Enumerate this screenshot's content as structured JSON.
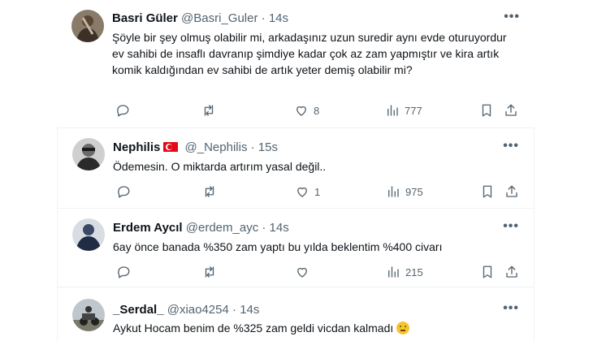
{
  "colors": {
    "text": "#0f1419",
    "secondary": "#536471",
    "divider": "#eff3f4",
    "flag_red": "#e30a17"
  },
  "tweets": [
    {
      "name": "Basri Güler",
      "handle": "@Basri_Guler",
      "time": "14s",
      "text": "Şöyle bir şey olmuş olabilir mi, arkadaşınız uzun suredir aynı evde oturuyordur ev sahibi de insaflı davranıp şimdiye kadar çok az zam yapmıştır ve kira artık komik kaldığından ev sahibi de artık yeter demiş olabilir mi?",
      "likes": "8",
      "views": "777"
    },
    {
      "name": "Nephilis",
      "flag": "turkey-flag",
      "handle": "@_Nephilis",
      "time": "15s",
      "text": "Ödemesin. O miktarda artırım yasal değil..",
      "likes": "1",
      "views": "975"
    },
    {
      "name": "Erdem Aycıl",
      "handle": "@erdem_ayc",
      "time": "14s",
      "text": "6ay önce banada %350 zam yaptı bu yılda beklentim %400 civarı",
      "likes": "",
      "views": "215"
    },
    {
      "name": "_Serdal_",
      "handle": "@xiao4254",
      "time": "14s",
      "text": "Aykut Hocam benim de %325 zam geldi vicdan kalmadı",
      "emoji": "neutral-face-emoji"
    }
  ],
  "more_icon": "•••",
  "dot": "·"
}
